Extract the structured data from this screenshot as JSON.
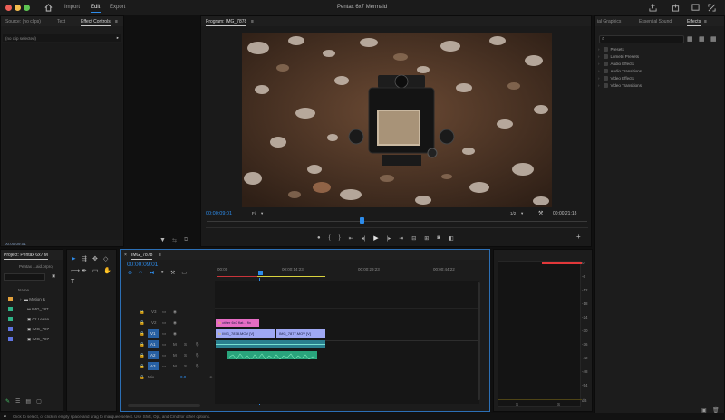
{
  "app": {
    "project_title": "Pentax 6x7 Mermaid",
    "menu": {
      "import": "Import",
      "edit": "Edit",
      "export": "Export"
    }
  },
  "source_panel": {
    "tabs": [
      "Source: (no clips)",
      "Text",
      "Effect Controls"
    ],
    "no_clip": "(no clip selected)",
    "timecode": "00:00:09:01"
  },
  "program_monitor": {
    "title": "Program: IMG_7878",
    "timecode": "00:00:09:01",
    "fit": "Fit",
    "resolution": "1/2",
    "duration": "00:00:21:18"
  },
  "effects_panel": {
    "tabs": [
      "ial Graphics",
      "Essential Sound",
      "Effects"
    ],
    "items": [
      "Presets",
      "Lumetri Presets",
      "Audio Effects",
      "Audio Transitions",
      "Video Effects",
      "Video Transitions"
    ]
  },
  "project_panel": {
    "tab": "Project: Pentax 6x7 M",
    "file": "Pentax ...aid.prproj",
    "column": "Name",
    "items": [
      "Motion &",
      "IMG_787",
      "02 Lease",
      "IMG_787",
      "IMG_787"
    ]
  },
  "timeline": {
    "tab": "IMG_7878",
    "timecode": "00:00:09:01",
    "ruler": [
      "00:00",
      "00:00:14:23",
      "00:00:29:23",
      "00:00:44:22"
    ],
    "tracks": [
      "V3",
      "V2",
      "V1",
      "A1",
      "A2",
      "A3"
    ],
    "v1_label": "V1",
    "a1_label": "A1",
    "mix": "Mix",
    "mix_value": "0.0",
    "clips": {
      "pink": "other 6x7 flat... fix",
      "v1a": "IMG_7878.MOV [V]",
      "v1b": "IMG_7877.MOV [V]"
    }
  },
  "meter": {
    "scale": [
      "0",
      "-6",
      "-12",
      "-18",
      "-24",
      "-30",
      "-36",
      "-42",
      "-48",
      "-54",
      "dB"
    ],
    "bottom": [
      "S",
      "S"
    ]
  },
  "status": "Click to select, or click in empty space and drag to marquee select. Use Shift, Opt, and Cmd for other options.",
  "colors": {
    "accent": "#2d8ceb",
    "pink_clip": "#e56cc4",
    "video_clip": "#9fa8f3",
    "audio_clip": "#29a47c",
    "meter_peak": "#e2383a"
  }
}
